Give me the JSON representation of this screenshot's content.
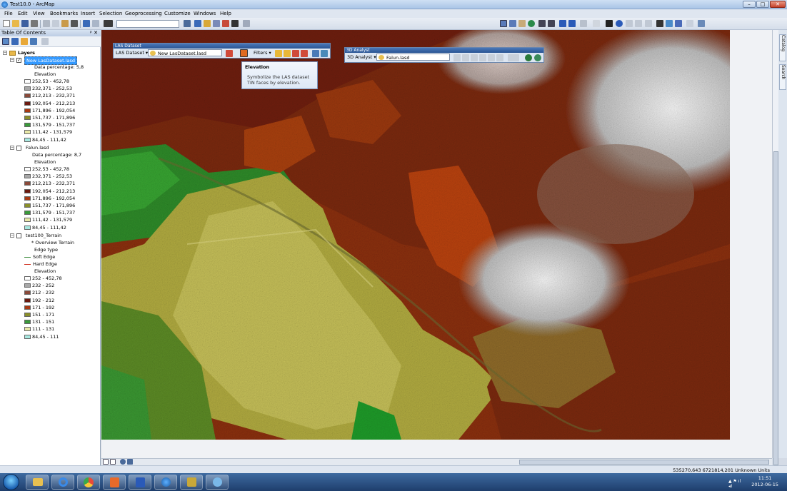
{
  "window": {
    "title": "Test10.0 - ArcMap",
    "minimize": "–",
    "maximize": "□",
    "close": "✕"
  },
  "menu": [
    "File",
    "Edit",
    "View",
    "Bookmarks",
    "Insert",
    "Selection",
    "Geoprocessing",
    "Customize",
    "Windows",
    "Help"
  ],
  "toc": {
    "title": "Table Of Contents",
    "pin": "ᵖ ✕",
    "layers_label": "Layers",
    "layer1": {
      "name": "New LasDataset.lasd",
      "data_percentage": "Data percentage: 5,8",
      "field": "Elevation",
      "classes": [
        "252,53 - 452,78",
        "232,371 - 252,53",
        "212,213 - 232,371",
        "192,054 - 212,213",
        "171,896 - 192,054",
        "151,737 - 171,896",
        "131,579 - 151,737",
        "111,42 - 131,579",
        "84,45 - 111,42"
      ],
      "colors": [
        "#ffffff",
        "#a8a8a8",
        "#8a4a3a",
        "#6b1a10",
        "#a83a14",
        "#8a8f2a",
        "#3a9a3a",
        "#e8e8a8",
        "#a8e8e0"
      ]
    },
    "layer2": {
      "name": "Falun.lasd",
      "data_percentage": "Data percentage: 8,7",
      "field": "Elevation",
      "classes": [
        "252,53 - 452,78",
        "232,371 - 252,53",
        "212,213 - 232,371",
        "192,054 - 212,213",
        "171,896 - 192,054",
        "151,737 - 171,896",
        "131,579 - 151,737",
        "111,42 - 131,579",
        "84,45 - 111,42"
      ]
    },
    "layer3": {
      "name": "test100_Terrain",
      "overview": "* Overview Terrain",
      "edge_type": "Edge type",
      "soft_edge": "Soft Edge",
      "hard_edge": "Hard Edge",
      "field": "Elevation",
      "classes": [
        "252 - 452,78",
        "232 - 252",
        "212 - 232",
        "192 - 212",
        "171 - 192",
        "151 - 171",
        "131 - 151",
        "111 - 131",
        "84,45 - 111"
      ]
    }
  },
  "las_toolbar": {
    "title": "LAS Dataset",
    "menu": "LAS Dataset ▾",
    "layer": "New LasDataset.lasd",
    "filters": "Filters ▾"
  },
  "analyst_toolbar": {
    "title": "3D Analyst",
    "menu": "3D Analyst ▾",
    "layer": "Falun.lasd"
  },
  "tooltip": {
    "title": "Elevation",
    "text": "Symbolize the LAS dataset TIN faces by elevation."
  },
  "side_tabs": [
    "Catalog",
    "Search"
  ],
  "status": {
    "coords": "535270,643  6721814,201 Unknown Units"
  },
  "taskbar": {
    "time": "11:51",
    "date": "2012-06-15"
  },
  "colors": {
    "accent": "#2a5593",
    "selection": "#3399ff"
  }
}
